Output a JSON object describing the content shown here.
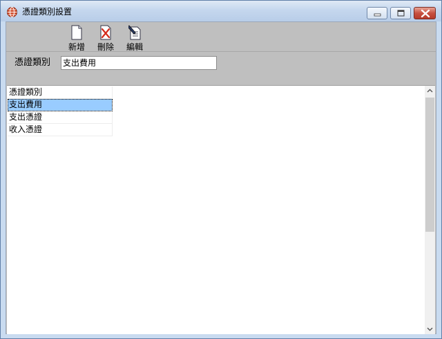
{
  "window": {
    "title": "憑證類別設置",
    "icons": {
      "app": "globe-icon",
      "minimize": "minimize-icon",
      "maximize": "maximize-icon",
      "close": "close-icon"
    }
  },
  "toolbar": {
    "items": [
      {
        "label": "新增",
        "icon": "new-document-icon"
      },
      {
        "label": "刪除",
        "icon": "delete-icon"
      },
      {
        "label": "編輯",
        "icon": "edit-icon"
      }
    ]
  },
  "form": {
    "category_label": "憑證類別",
    "category_value": "支出費用"
  },
  "list": {
    "header": "憑證類別",
    "rows": [
      "支出費用",
      "支出憑證",
      "收入憑證"
    ],
    "selected_index": 0
  },
  "colors": {
    "selection": "#99ccff",
    "panel": "#bfbfbf",
    "close_button": "#c75040"
  }
}
